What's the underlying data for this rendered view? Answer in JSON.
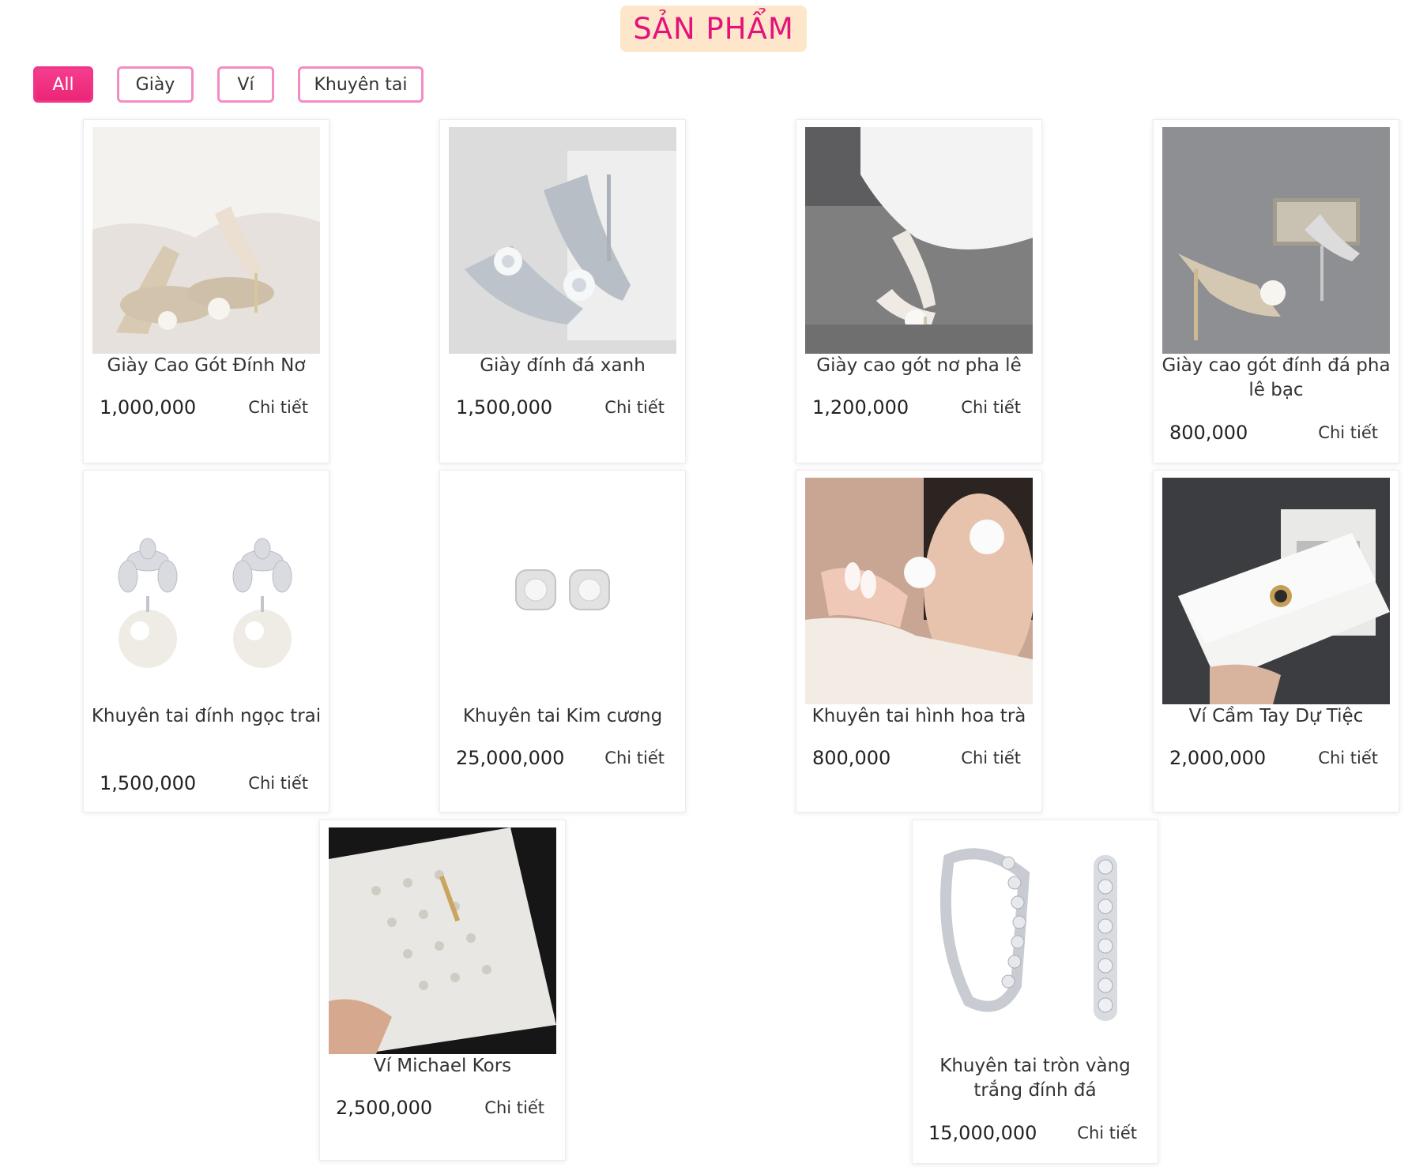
{
  "header": {
    "title": "SẢN PHẨM"
  },
  "filters": [
    "All",
    "Giày",
    "Ví",
    "Khuyên tai"
  ],
  "active_filter": "All",
  "colors": {
    "accent": "#ec2677",
    "title_bg": "#fde6c9",
    "title_text": "#e4127b",
    "filter_border": "#f28cc3"
  },
  "products": [
    {
      "name": "Giày Cao Gót Đính Nơ",
      "price": "1,000,000",
      "detail_label": "Chi tiết"
    },
    {
      "name": "Giày đính đá xanh",
      "price": "1,500,000",
      "detail_label": "Chi tiết"
    },
    {
      "name": "Giày cao gót nơ pha lê",
      "price": "1,200,000",
      "detail_label": "Chi tiết"
    },
    {
      "name": "Giày cao gót đính đá pha lê bạc",
      "price": "800,000",
      "detail_label": "Chi tiết"
    },
    {
      "name": "Khuyên tai đính ngọc trai",
      "price": "1,500,000",
      "detail_label": "Chi tiết"
    },
    {
      "name": "Khuyên tai Kim cương",
      "price": "25,000,000",
      "detail_label": "Chi tiết"
    },
    {
      "name": "Khuyên tai hình hoa trà",
      "price": "800,000",
      "detail_label": "Chi tiết"
    },
    {
      "name": "Ví Cầm Tay Dự Tiệc",
      "price": "2,000,000",
      "detail_label": "Chi tiết"
    },
    {
      "name": "Ví Michael Kors",
      "price": "2,500,000",
      "detail_label": "Chi tiết"
    },
    {
      "name": "Khuyên tai tròn vàng trắng đính đá",
      "price": "15,000,000",
      "detail_label": "Chi tiết"
    }
  ]
}
